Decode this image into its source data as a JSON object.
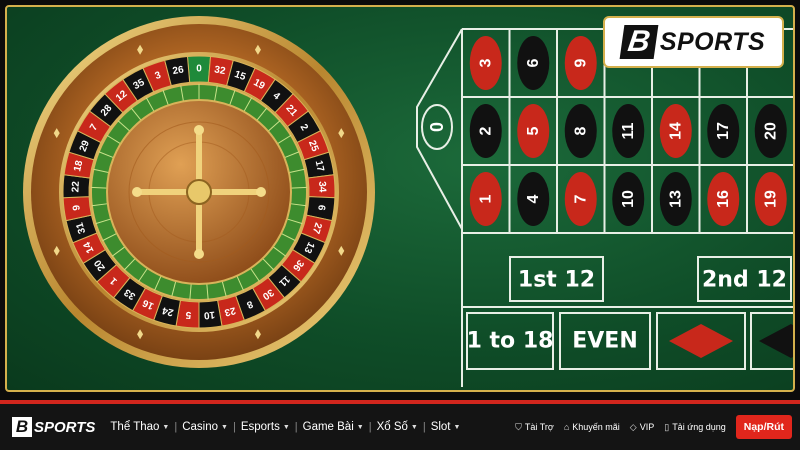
{
  "hero": {
    "logo": {
      "mark": "B",
      "word": "SPORTS"
    },
    "zero": "0",
    "board_numbers": [
      {
        "row": 0,
        "col": 0,
        "n": "3",
        "color": "red"
      },
      {
        "row": 0,
        "col": 1,
        "n": "6",
        "color": "black"
      },
      {
        "row": 0,
        "col": 2,
        "n": "9",
        "color": "red"
      },
      {
        "row": 1,
        "col": 0,
        "n": "2",
        "color": "black"
      },
      {
        "row": 1,
        "col": 1,
        "n": "5",
        "color": "red"
      },
      {
        "row": 1,
        "col": 2,
        "n": "8",
        "color": "black"
      },
      {
        "row": 1,
        "col": 3,
        "n": "11",
        "color": "black"
      },
      {
        "row": 1,
        "col": 4,
        "n": "14",
        "color": "red"
      },
      {
        "row": 1,
        "col": 5,
        "n": "17",
        "color": "black"
      },
      {
        "row": 1,
        "col": 6,
        "n": "20",
        "color": "black"
      },
      {
        "row": 2,
        "col": 0,
        "n": "1",
        "color": "red"
      },
      {
        "row": 2,
        "col": 1,
        "n": "4",
        "color": "black"
      },
      {
        "row": 2,
        "col": 2,
        "n": "7",
        "color": "red"
      },
      {
        "row": 2,
        "col": 3,
        "n": "10",
        "color": "black"
      },
      {
        "row": 2,
        "col": 4,
        "n": "13",
        "color": "black"
      },
      {
        "row": 2,
        "col": 5,
        "n": "16",
        "color": "red"
      },
      {
        "row": 2,
        "col": 6,
        "n": "19",
        "color": "red"
      }
    ],
    "dozens": [
      "1st 12",
      "2nd 12"
    ],
    "outside": [
      "1 to 18",
      "EVEN"
    ],
    "wheel_numbers": [
      "0",
      "32",
      "15",
      "19",
      "4",
      "21",
      "2",
      "25",
      "17",
      "34",
      "6",
      "27",
      "13",
      "36",
      "11",
      "30",
      "8",
      "23",
      "10",
      "5",
      "24",
      "16",
      "33",
      "1",
      "20",
      "14",
      "31",
      "9",
      "22",
      "18",
      "29",
      "7",
      "28",
      "12",
      "35",
      "3",
      "26"
    ],
    "colors": {
      "red": "#c8281b",
      "black": "#111111",
      "green": "#0f5a2d",
      "gold": "#d4b04c"
    }
  },
  "nav": {
    "brand": {
      "mark": "B",
      "word": "SPORTS"
    },
    "menu": [
      {
        "label": "Thể Thao"
      },
      {
        "label": "Casino"
      },
      {
        "label": "Esports"
      },
      {
        "label": "Game Bài"
      },
      {
        "label": "Xổ Số"
      },
      {
        "label": "Slot"
      }
    ],
    "links": [
      {
        "label": "Tài Trợ",
        "icon": "shield-icon"
      },
      {
        "label": "Khuyến mãi",
        "icon": "tag-icon"
      },
      {
        "label": "VIP",
        "icon": "diamond-icon"
      },
      {
        "label": "Tải ứng dụng",
        "icon": "phone-icon"
      }
    ],
    "cta": "Nạp/Rút"
  }
}
